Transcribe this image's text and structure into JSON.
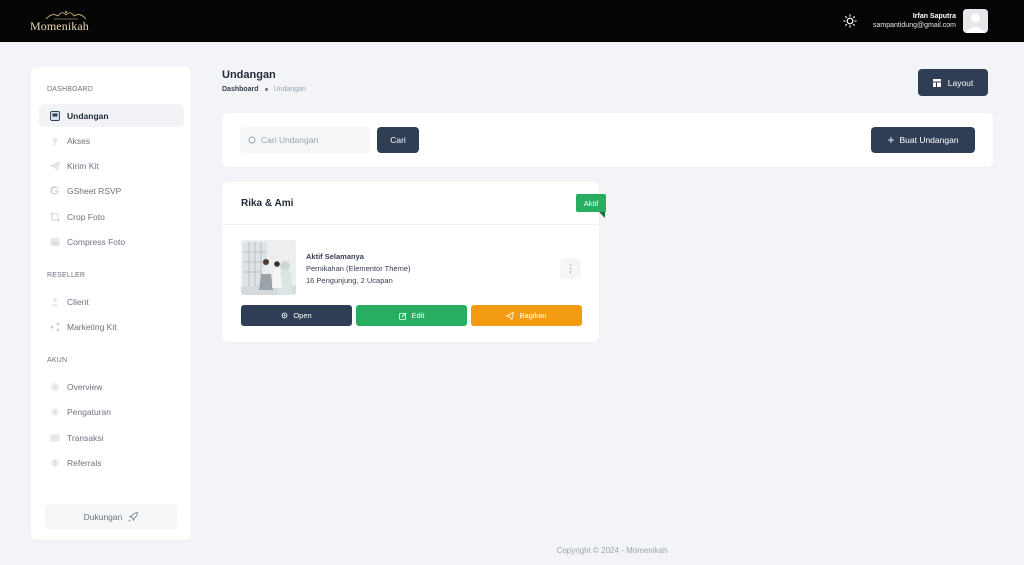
{
  "header": {
    "brand": "Momenikah",
    "user_name": "Irfan Saputra",
    "user_email": "sampantidung@gmail.com"
  },
  "sidebar": {
    "sections": [
      {
        "heading": "DASHBOARD",
        "items": [
          {
            "label": "Undangan",
            "icon": "invitation-icon",
            "active": true
          },
          {
            "label": "Akses",
            "icon": "access-icon"
          },
          {
            "label": "Kirim Kit",
            "icon": "send-icon"
          },
          {
            "label": "GSheet RSVP",
            "icon": "google-icon"
          },
          {
            "label": "Crop Foto",
            "icon": "crop-icon"
          },
          {
            "label": "Compress Foto",
            "icon": "compress-icon"
          }
        ]
      },
      {
        "heading": "RESELLER",
        "items": [
          {
            "label": "Client",
            "icon": "user-icon"
          },
          {
            "label": "Marketing Kit",
            "icon": "marketing-icon"
          }
        ]
      },
      {
        "heading": "AKUN",
        "items": [
          {
            "label": "Overview",
            "icon": "overview-icon"
          },
          {
            "label": "Pengaturan",
            "icon": "settings-icon"
          },
          {
            "label": "Transaksi",
            "icon": "transaction-icon"
          },
          {
            "label": "Referrals",
            "icon": "referral-icon"
          }
        ]
      }
    ],
    "support_label": "Dukungan"
  },
  "page": {
    "title": "Undangan",
    "breadcrumb": [
      "Dashboard",
      "Undangan"
    ],
    "layout_label": "Layout"
  },
  "search": {
    "placeholder": "Cari Undangan",
    "button_label": "Cari",
    "create_label": "Buat Undangan"
  },
  "invitation": {
    "title": "Rika & Ami",
    "status": "Aktif",
    "plan": "Aktif Selamanya",
    "theme": "Pernikahan (Elementor Theme)",
    "stats": "16 Pengunjung, 2 Ucapan",
    "actions": {
      "open": "Open",
      "edit": "Edit",
      "share": "Bagikan"
    }
  },
  "footer": {
    "text": "Copyright © 2024 - Momenikah"
  },
  "colors": {
    "primary": "#2f3e54",
    "success": "#27ae60",
    "warning": "#f39c12",
    "topbar": "#050505"
  }
}
